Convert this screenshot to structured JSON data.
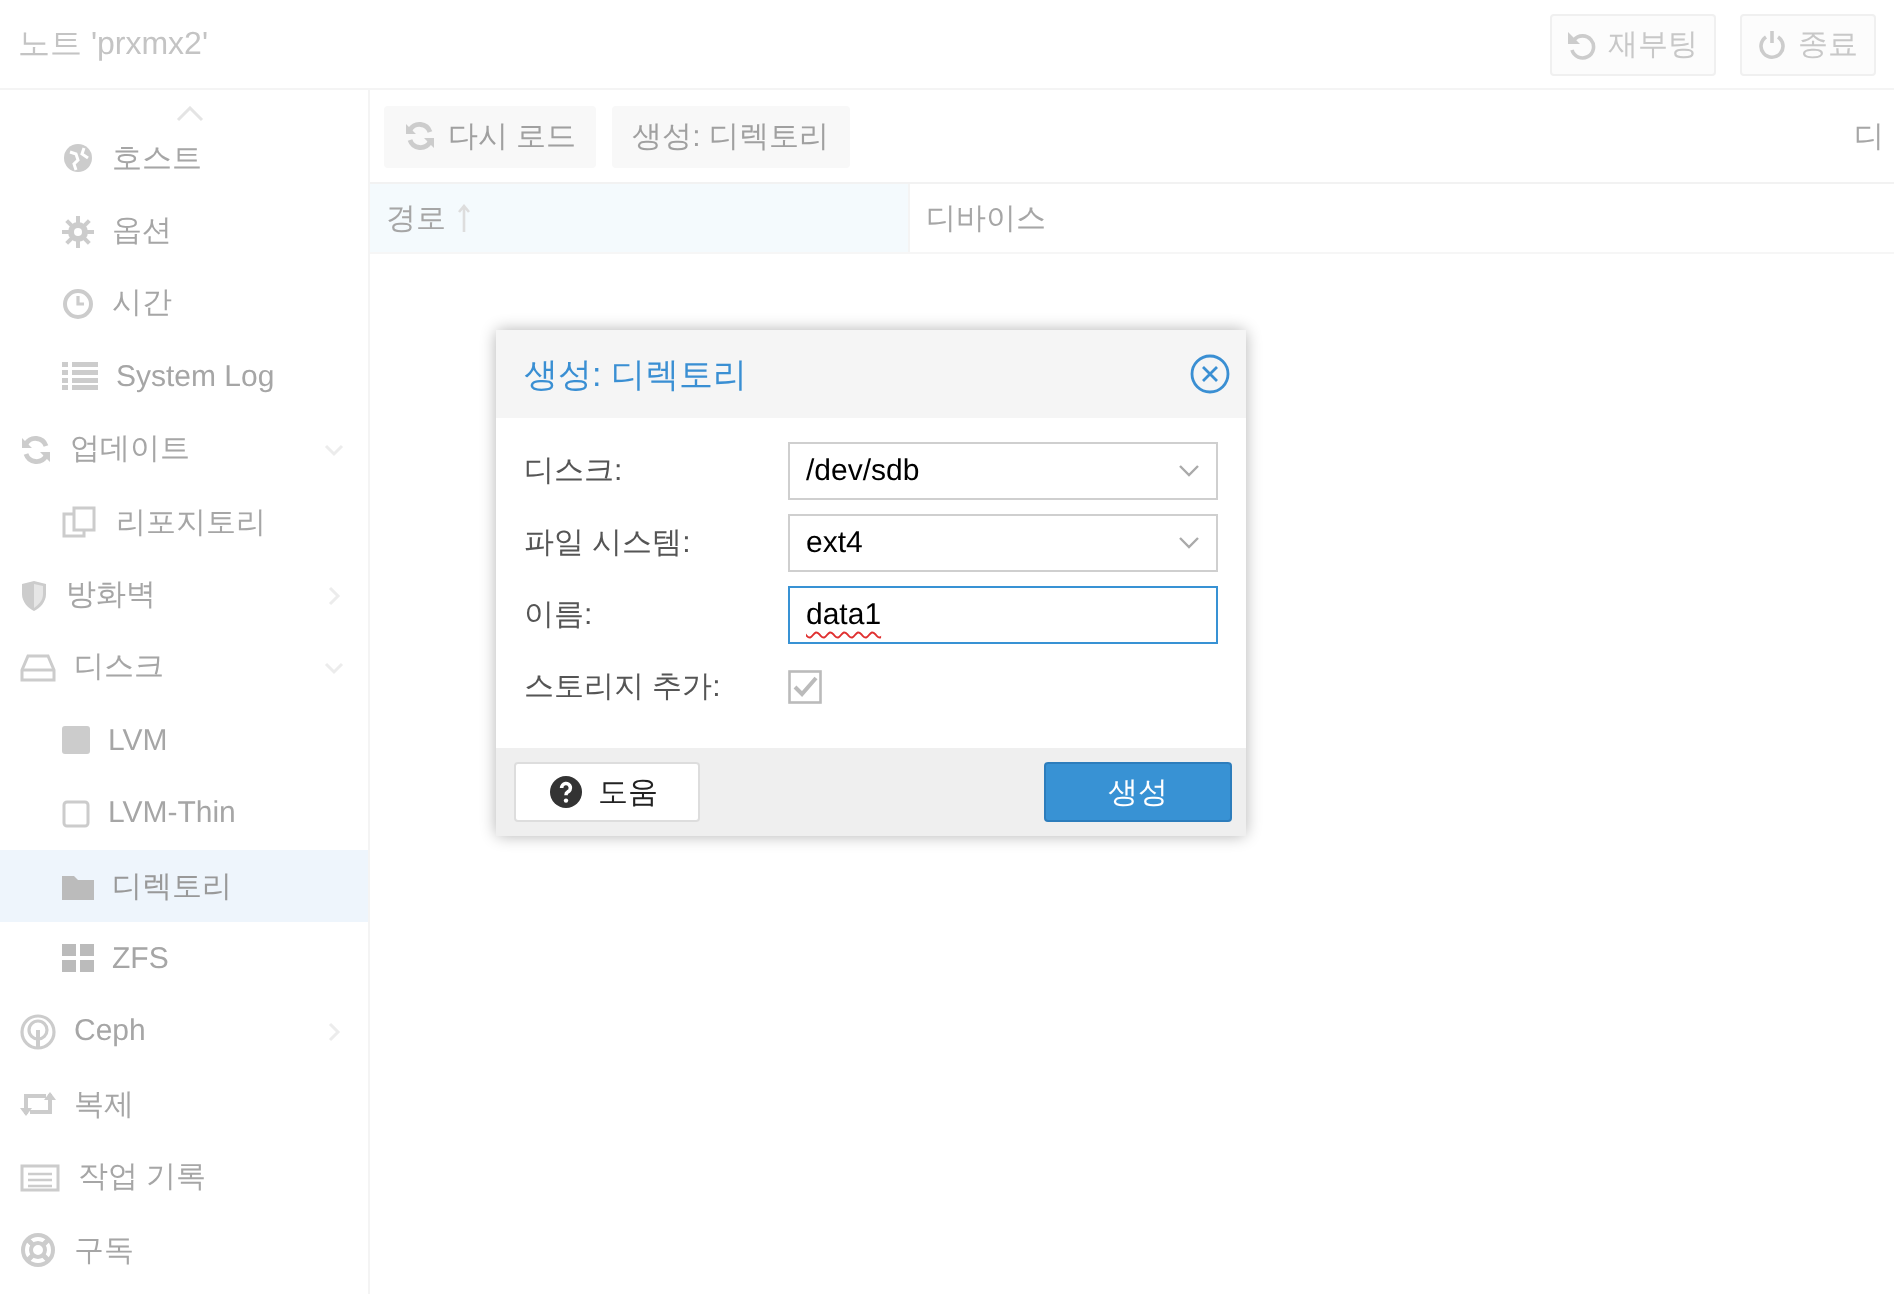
{
  "header": {
    "title": "노트 'prxmx2'",
    "buttons": [
      {
        "label": "재부팅",
        "kind": "reboot"
      },
      {
        "label": "종료",
        "kind": "shutdown"
      }
    ]
  },
  "sidebar": {
    "leading_items": [
      {
        "label": "호스트",
        "selected": false
      },
      {
        "label": "옵션",
        "selected": false
      },
      {
        "label": "시간",
        "selected": false
      },
      {
        "label": "System Log",
        "selected": false
      }
    ],
    "items": [
      {
        "label": "업데이트",
        "selected": false,
        "expanded": true,
        "children": [
          {
            "label": "리포지토리",
            "selected": false
          }
        ]
      },
      {
        "label": "방화벽",
        "selected": false,
        "expanded": false
      },
      {
        "label": "디스크",
        "selected": false,
        "expanded": true,
        "children": [
          {
            "label": "LVM",
            "selected": false
          },
          {
            "label": "LVM-Thin",
            "selected": false
          },
          {
            "label": "디렉토리",
            "selected": true
          },
          {
            "label": "ZFS",
            "selected": false
          }
        ]
      },
      {
        "label": "Ceph",
        "selected": false,
        "expanded": false
      },
      {
        "label": "복제",
        "selected": false
      },
      {
        "label": "작업 기록",
        "selected": false
      },
      {
        "label": "구독",
        "selected": false
      }
    ]
  },
  "toolbar": {
    "buttons": [
      "다시 로드",
      "생성: 디렉토리"
    ],
    "trailing_text": "디"
  },
  "table": {
    "columns": [
      {
        "label": "경로",
        "sorted": true
      },
      {
        "label": "디바이스",
        "sorted": false
      }
    ]
  },
  "dialog": {
    "title": "생성: 디렉토리",
    "fields": [
      {
        "label": "디스크:",
        "kind": "combo",
        "value": "/dev/sdb"
      },
      {
        "label": "파일 시스템:",
        "kind": "combo",
        "value": "ext4"
      },
      {
        "label": "이름:",
        "kind": "text",
        "value": "data1",
        "focused": true
      },
      {
        "label": "스토리지 추가:",
        "kind": "checkbox",
        "checked": true,
        "disabled": true
      }
    ],
    "help_button": "도움",
    "submit_button": "생성"
  }
}
